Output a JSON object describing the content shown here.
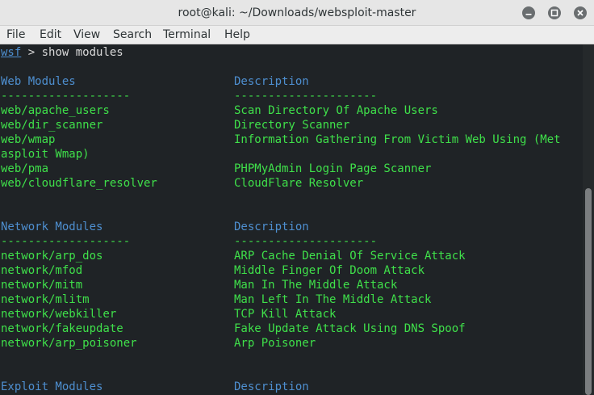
{
  "window": {
    "title": "root@kali: ~/Downloads/websploit-master",
    "controls": [
      "minimize-icon",
      "maximize-icon",
      "close-icon"
    ]
  },
  "menu": [
    "File",
    "Edit",
    "View",
    "Search",
    "Terminal",
    "Help"
  ],
  "terminal": {
    "prompt": {
      "name": "wsf",
      "rest": " > show modules"
    },
    "web": {
      "heading": "Web Modules",
      "desc_heading": "Description",
      "sep1": "-------------------",
      "sep2": "---------------------",
      "rows": [
        {
          "module": "web/apache_users",
          "desc": "Scan Directory Of Apache Users"
        },
        {
          "module": "web/dir_scanner",
          "desc": "Directory Scanner"
        },
        {
          "module": "web/wmap",
          "desc": "Information Gathering From Victim Web Using (Met"
        },
        {
          "module": "asploit Wmap)",
          "desc": ""
        },
        {
          "module": "web/pma",
          "desc": "PHPMyAdmin Login Page Scanner"
        },
        {
          "module": "web/cloudflare_resolver",
          "desc": "CloudFlare Resolver"
        }
      ]
    },
    "network": {
      "heading": "Network Modules",
      "desc_heading": "Description",
      "sep1": "-------------------",
      "sep2": "---------------------",
      "rows": [
        {
          "module": "network/arp_dos",
          "desc": "ARP Cache Denial Of Service Attack"
        },
        {
          "module": "network/mfod",
          "desc": "Middle Finger Of Doom Attack"
        },
        {
          "module": "network/mitm",
          "desc": "Man In The Middle Attack"
        },
        {
          "module": "network/mlitm",
          "desc": "Man Left In The Middle Attack"
        },
        {
          "module": "network/webkiller",
          "desc": "TCP Kill Attack"
        },
        {
          "module": "network/fakeupdate",
          "desc": "Fake Update Attack Using DNS Spoof"
        },
        {
          "module": "network/arp_poisoner",
          "desc": "Arp Poisoner"
        }
      ]
    },
    "exploit": {
      "heading": "Exploit Modules",
      "desc_heading": "Description"
    }
  },
  "colors": {
    "background": "#1f2326",
    "module_text": "#3fe04a",
    "heading_text": "#4e8fd0"
  }
}
